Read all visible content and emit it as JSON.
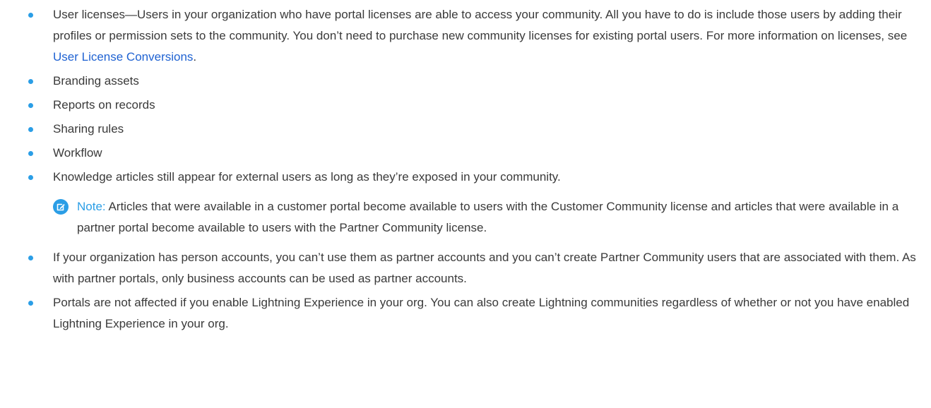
{
  "colors": {
    "bullet": "#2b9ee6",
    "text": "#3a3a3a",
    "link": "#1f62d2",
    "note_accent": "#2b9ee6"
  },
  "bullets_top": [
    {
      "text_before": "User licenses—Users in your organization who have portal licenses are able to access your community. All you have to do is include those users by adding their profiles or permission sets to the community. You don’t need to purchase new community licenses for existing portal users. For more information on licenses, see ",
      "link": "User License Conversions",
      "text_after": "."
    },
    {
      "text": "Branding assets"
    },
    {
      "text": "Reports on records"
    },
    {
      "text": "Sharing rules"
    },
    {
      "text": "Workflow"
    },
    {
      "text": "Knowledge articles still appear for external users as long as they’re exposed in your community."
    }
  ],
  "note": {
    "icon": "edit-note-icon",
    "label": "Note:",
    "text": "Articles that were available in a customer portal become available to users with the Customer Community license and articles that were available in a partner portal become available to users with the Partner Community license."
  },
  "bullets_bottom": [
    {
      "text": "If your organization has person accounts, you can’t use them as partner accounts and you can’t create Partner Community users that are associated with them. As with partner portals, only business accounts can be used as partner accounts."
    },
    {
      "text": "Portals are not affected if you enable Lightning Experience in your org. You can also create Lightning communities regardless of whether or not you have enabled Lightning Experience in your org."
    }
  ]
}
